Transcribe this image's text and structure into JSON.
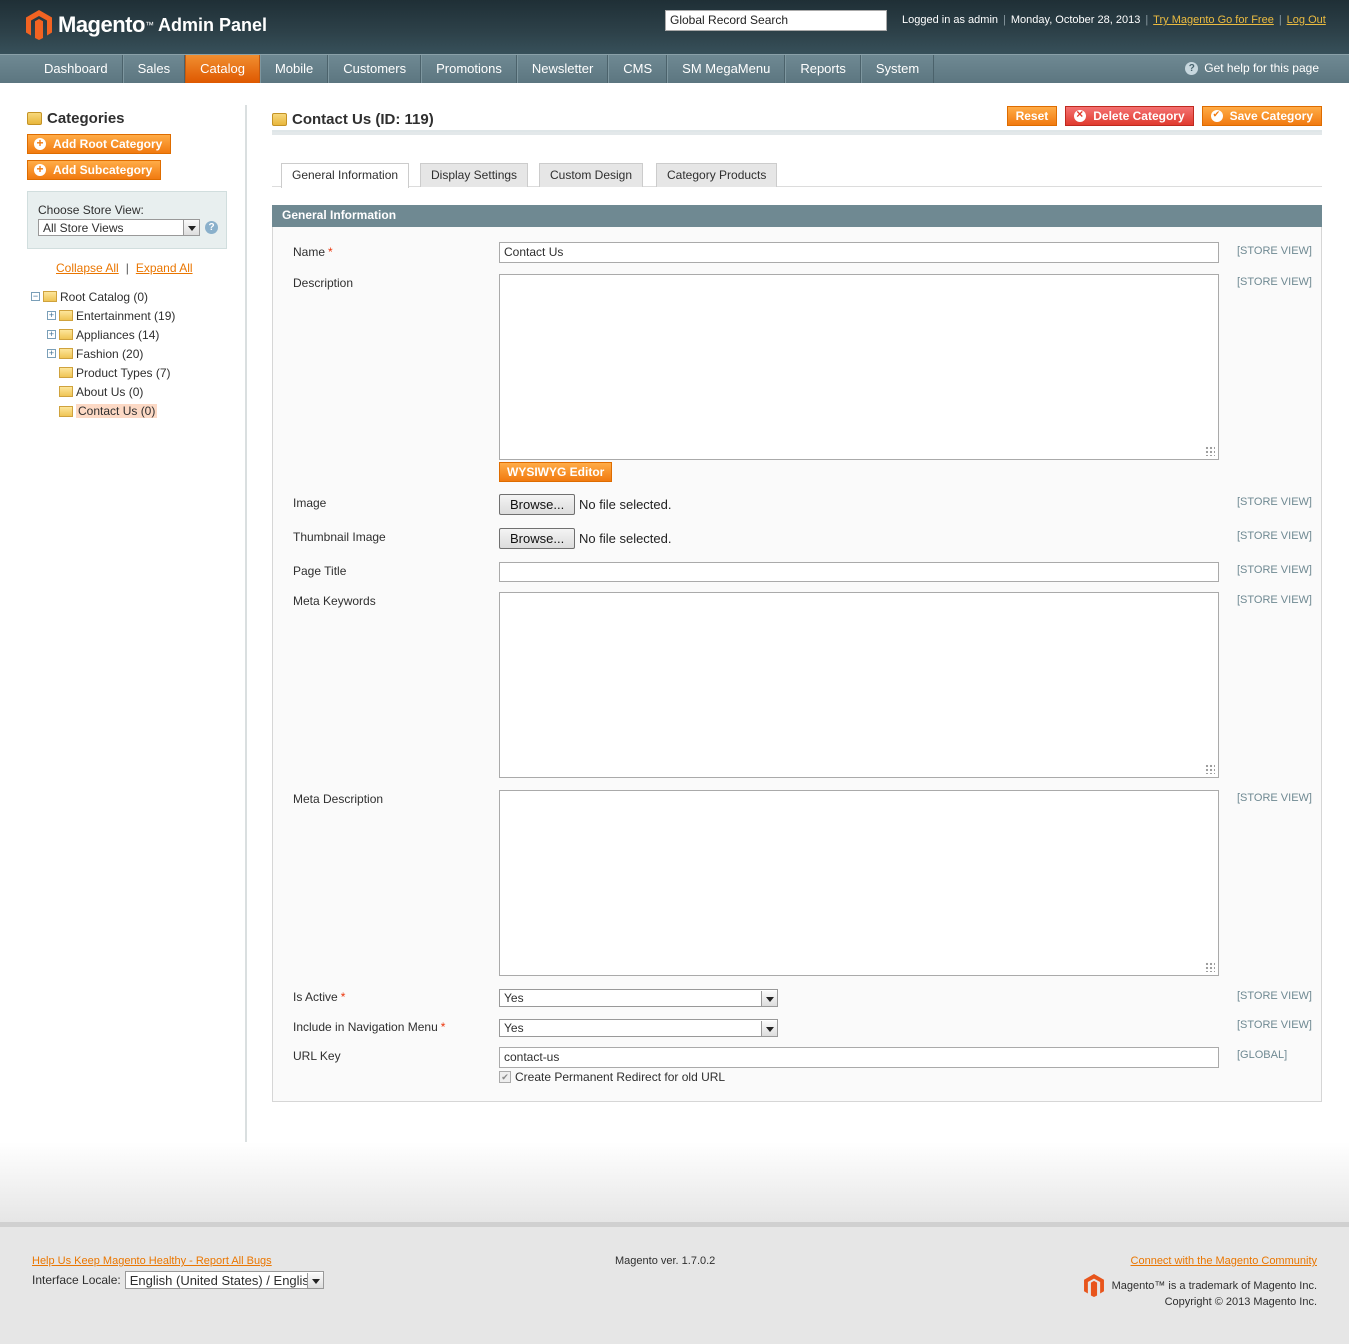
{
  "header": {
    "brand": "Magento",
    "brand_tm": "™",
    "brand_sub": "Admin Panel",
    "search_value": "Global Record Search",
    "logged_in": "Logged in as admin",
    "date": "Monday, October 28, 2013",
    "try_link": "Try Magento Go for Free",
    "logout_link": "Log Out"
  },
  "nav": {
    "items": [
      "Dashboard",
      "Sales",
      "Catalog",
      "Mobile",
      "Customers",
      "Promotions",
      "Newsletter",
      "CMS",
      "SM MegaMenu",
      "Reports",
      "System"
    ],
    "active": "Catalog",
    "help": "Get help for this page"
  },
  "sidebar": {
    "title": "Categories",
    "add_root": "Add Root Category",
    "add_sub": "Add Subcategory",
    "store_label": "Choose Store View:",
    "store_value": "All Store Views",
    "collapse": "Collapse All",
    "separator": "|",
    "expand": "Expand All",
    "tree": [
      {
        "label": "Root Catalog (0)",
        "toggle": "−"
      },
      {
        "label": "Entertainment (19)",
        "toggle": "+"
      },
      {
        "label": "Appliances (14)",
        "toggle": "+"
      },
      {
        "label": "Fashion (20)",
        "toggle": "+"
      },
      {
        "label": "Product Types (7)",
        "toggle": ""
      },
      {
        "label": "About Us (0)",
        "toggle": ""
      },
      {
        "label": "Contact Us (0)",
        "toggle": "",
        "selected": true
      }
    ]
  },
  "main": {
    "title": "Contact Us (ID: 119)",
    "reset": "Reset",
    "delete": "Delete Category",
    "save": "Save Category",
    "tabs": [
      "General Information",
      "Display Settings",
      "Custom Design",
      "Category Products"
    ],
    "section_title": "General Information",
    "fields": {
      "name_label": "Name",
      "name_value": "Contact Us",
      "description_label": "Description",
      "wysiwyg": "WYSIWYG Editor",
      "image_label": "Image",
      "thumb_label": "Thumbnail Image",
      "browse": "Browse...",
      "no_file": "No file selected.",
      "page_title_label": "Page Title",
      "meta_keywords_label": "Meta Keywords",
      "meta_desc_label": "Meta Description",
      "is_active_label": "Is Active",
      "is_active_value": "Yes",
      "nav_menu_label": "Include in Navigation Menu",
      "nav_menu_value": "Yes",
      "url_key_label": "URL Key",
      "url_key_value": "contact-us",
      "redirect_label": "Create Permanent Redirect for old URL",
      "required_mark": "*",
      "scope_store": "[STORE VIEW]",
      "scope_global": "[GLOBAL]"
    }
  },
  "footer": {
    "bug_link": "Help Us Keep Magento Healthy - Report All Bugs",
    "locale_label": "Interface Locale:",
    "locale_value": "English (United States) / English",
    "version": "Magento ver. 1.7.0.2",
    "community_link": "Connect with the Magento Community",
    "trademark": "Magento™ is a trademark of Magento Inc.",
    "copyright": "Copyright © 2013 Magento Inc."
  },
  "colors": {
    "accent_orange": "#f17a10",
    "header_dark": "#2d4149",
    "nav_slate": "#6f8993",
    "delete_red": "#e03a2e"
  }
}
